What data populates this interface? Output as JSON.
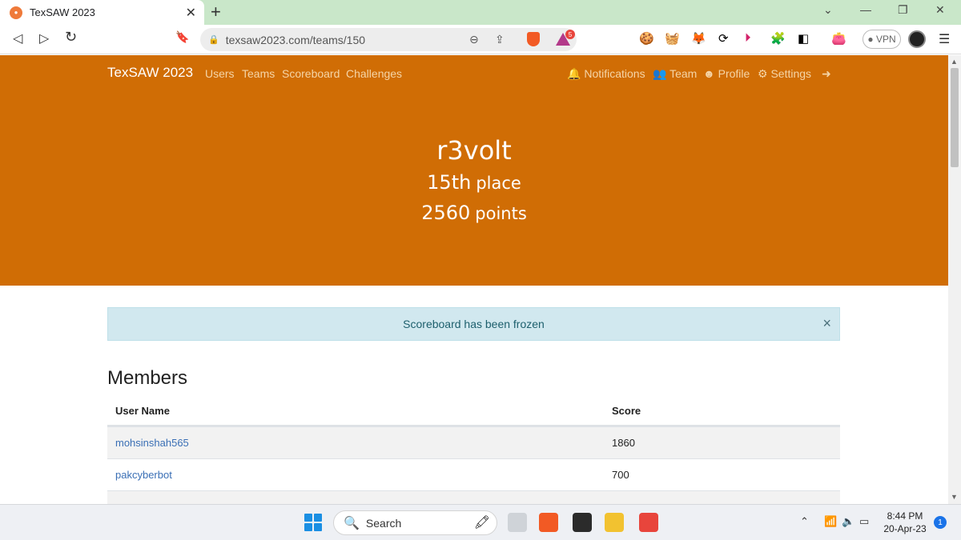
{
  "browser": {
    "tab_title": "TexSAW 2023",
    "tab_close": "✕",
    "new_tab": "+",
    "url": "texsaw2023.com/teams/150",
    "shield_badge": "5",
    "vpn_label": "● VPN",
    "window_controls": {
      "dropdown": "⌄",
      "minimize": "—",
      "restore": "❐",
      "close": "✕"
    }
  },
  "navbar": {
    "brand": "TexSAW 2023",
    "left_links": [
      "Users",
      "Teams",
      "Scoreboard",
      "Challenges"
    ],
    "right_links": {
      "notifications": "Notifications",
      "team": "Team",
      "profile": "Profile",
      "settings": "Settings"
    }
  },
  "hero": {
    "team_name": "r3volt",
    "place_value": "15th",
    "place_label": "place",
    "points_value": "2560",
    "points_label": "points",
    "background_color": "#d06d05"
  },
  "alert": {
    "text": "Scoreboard has been frozen",
    "close": "×"
  },
  "members": {
    "heading": "Members",
    "columns": [
      "User Name",
      "Score"
    ],
    "rows": [
      {
        "name": "mohsinshah565",
        "score": "1860"
      },
      {
        "name": "pakcyberbot",
        "score": "700"
      }
    ]
  },
  "taskbar": {
    "search_label": "Search",
    "time": "8:44 PM",
    "date": "20-Apr-23",
    "notification_count": "1"
  }
}
